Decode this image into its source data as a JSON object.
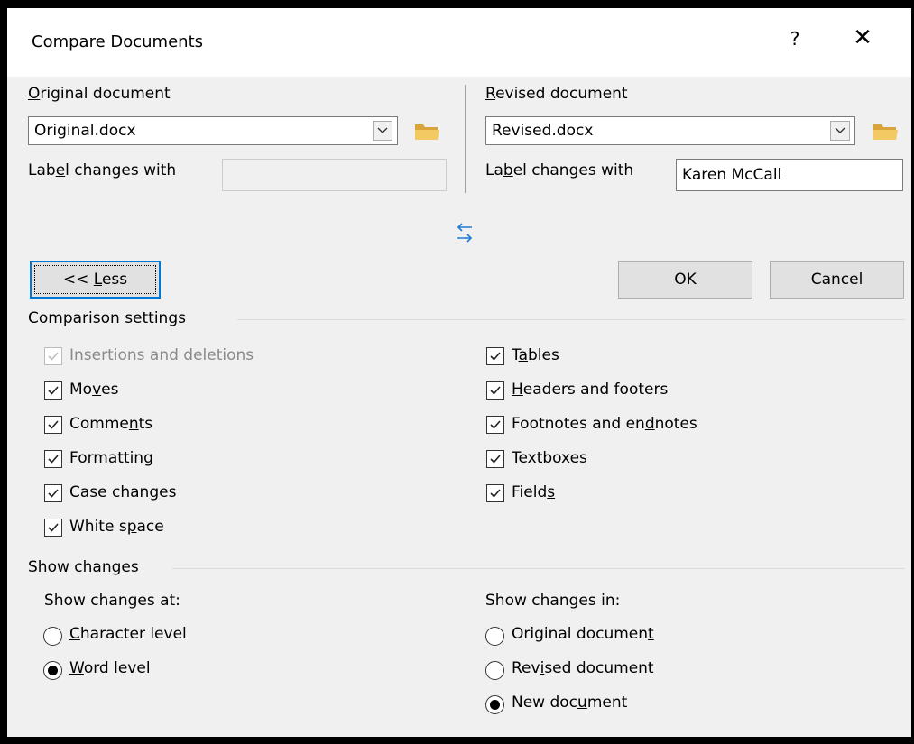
{
  "dialog": {
    "title": "Compare Documents",
    "help_label": "?",
    "close_label": "✕"
  },
  "original": {
    "label": "Original document",
    "value": "Original.docx",
    "label_changes": "Label changes with",
    "label_value": ""
  },
  "revised": {
    "label": "Revised document",
    "value": "Revised.docx",
    "label_changes": "Label changes with",
    "label_value": "Karen McCall"
  },
  "buttons": {
    "less": "<< Less",
    "ok": "OK",
    "cancel": "Cancel"
  },
  "comparison": {
    "heading": "Comparison settings",
    "left": [
      {
        "label": "Insertions and deletions",
        "checked": true,
        "disabled": true
      },
      {
        "label": "Moves",
        "checked": true
      },
      {
        "label": "Comments",
        "checked": true
      },
      {
        "label": "Formatting",
        "checked": true
      },
      {
        "label": "Case changes",
        "checked": true
      },
      {
        "label": "White space",
        "checked": true
      }
    ],
    "right": [
      {
        "label": "Tables",
        "checked": true
      },
      {
        "label": "Headers and footers",
        "checked": true
      },
      {
        "label": "Footnotes and endnotes",
        "checked": true
      },
      {
        "label": "Textboxes",
        "checked": true
      },
      {
        "label": "Fields",
        "checked": true
      }
    ]
  },
  "show_changes": {
    "heading": "Show changes",
    "at_label": "Show changes at:",
    "at_options": [
      {
        "label": "Character level",
        "selected": false
      },
      {
        "label": "Word level",
        "selected": true
      }
    ],
    "in_label": "Show changes in:",
    "in_options": [
      {
        "label": "Original document",
        "selected": false
      },
      {
        "label": "Revised document",
        "selected": false
      },
      {
        "label": "New document",
        "selected": true
      }
    ]
  },
  "colors": {
    "accent": "#0078d7",
    "folder": "#e8b341",
    "swap_arrow": "#1e7bd6"
  },
  "icons": {
    "swap": "swap-arrows-icon",
    "folder": "folder-icon",
    "dropdown": "chevron-down-icon"
  }
}
